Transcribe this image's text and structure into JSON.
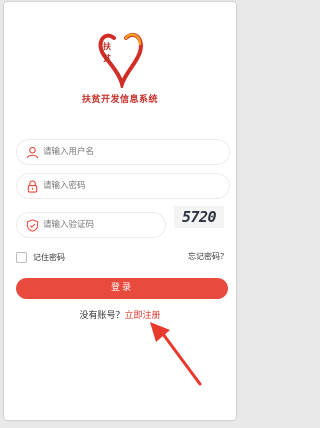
{
  "app": {
    "title": "扶贫开发信息系统",
    "logo_text": [
      "扶",
      "贫"
    ]
  },
  "form": {
    "username_placeholder": "请输入用户名",
    "password_placeholder": "请输入密码",
    "captcha_placeholder": "请输入验证码",
    "captcha_code": "5720",
    "remember_label": "记住密码",
    "forgot_label": "忘记密码？",
    "login_label": "登录"
  },
  "footer": {
    "no_account_text": "没有账号？",
    "register_link": "立即注册"
  },
  "colors": {
    "accent": "#e84a3d",
    "annotation_arrow": "#e8392c"
  },
  "icons": [
    "user-icon",
    "lock-icon",
    "shield-check-icon",
    "logo-heart-icon",
    "arrow-annotation-icon"
  ]
}
